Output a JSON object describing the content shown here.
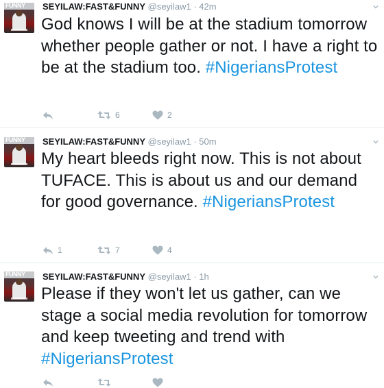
{
  "tweets": [
    {
      "avatar_label": "FUNNY",
      "name": "SEYILAW:FAST&FUNNY",
      "handle": "@seyilaw1",
      "sep": "·",
      "time": "42m",
      "text": "God knows I will be at the stadium tomorrow whether people gather or not. I have a right to be at the stadium too. ",
      "hashtag": "#NigeriansProtest",
      "actions": {
        "reply": "",
        "retweets": "6",
        "likes": "2"
      }
    },
    {
      "avatar_label": "FUNNY",
      "name": "SEYILAW:FAST&FUNNY",
      "handle": "@seyilaw1",
      "sep": "·",
      "time": "50m",
      "text": "My heart bleeds right now. This is not about TUFACE. This is about us and our demand for good governance. ",
      "hashtag": "#NigeriansProtest",
      "actions": {
        "reply": "1",
        "retweets": "7",
        "likes": "4"
      }
    },
    {
      "avatar_label": "FUNNY",
      "name": "SEYILAW:FAST&FUNNY",
      "handle": "@seyilaw1",
      "sep": "·",
      "time": "1h",
      "text": "Please if they won't let us gather, can we stage a social media revolution for tomorrow and keep tweeting and trend with ",
      "hashtag": "#NigeriansProtest",
      "actions": {
        "reply": "",
        "retweets": "",
        "likes": ""
      }
    }
  ],
  "icons": {
    "reply": "reply-icon",
    "retweet": "retweet-icon",
    "like": "heart-icon",
    "caret": "chevron-down-icon"
  },
  "colors": {
    "hashtag": "#1b95e0",
    "meta": "#8899a6",
    "icon": "#aab8c2",
    "divider": "#e6ecf0"
  }
}
